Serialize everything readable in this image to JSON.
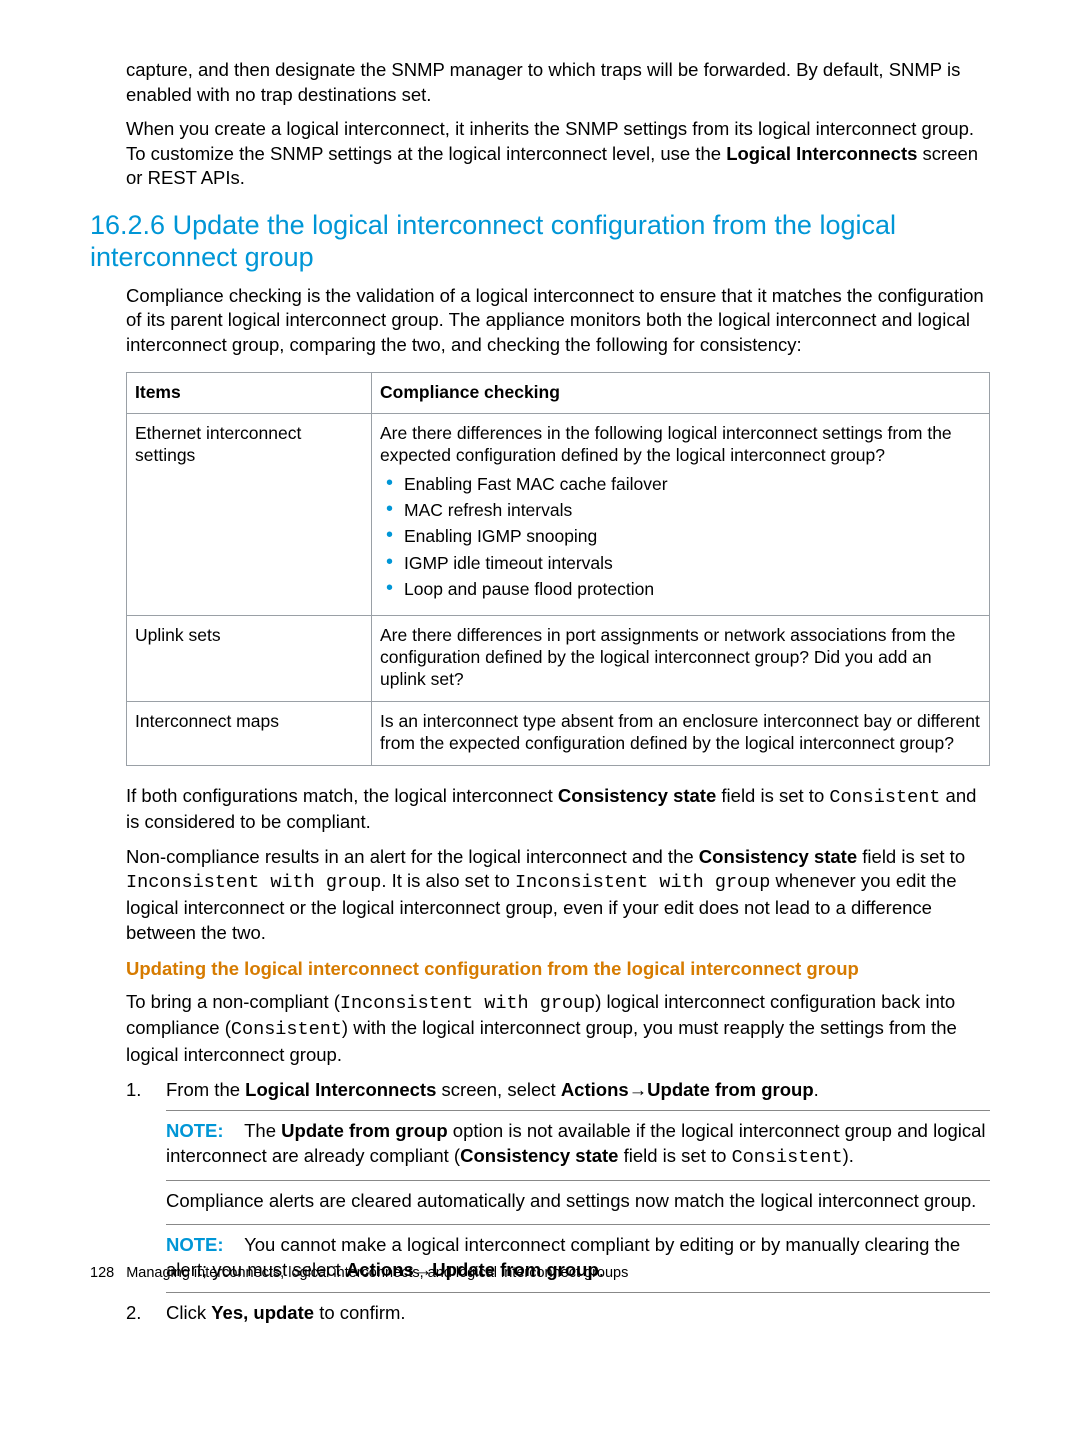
{
  "intro": {
    "p1_a": "capture, and then designate the SNMP manager to which traps will be forwarded. By default, SNMP is enabled with no trap destinations set.",
    "p2_a": "When you create a logical interconnect, it inherits the SNMP settings from its logical interconnect group. To customize the SNMP settings at the logical interconnect level, use the ",
    "p2_bold": "Logical Interconnects",
    "p2_b": " screen or REST APIs."
  },
  "section_heading": "16.2.6 Update the logical interconnect configuration from the logical interconnect group",
  "compliance_intro": "Compliance checking is the validation of a logical interconnect to ensure that it matches the configuration of its parent logical interconnect group. The appliance monitors both the logical interconnect and logical interconnect group, comparing the two, and checking the following for consistency:",
  "table": {
    "headers": {
      "items": "Items",
      "checking": "Compliance checking"
    },
    "rows": [
      {
        "item": "Ethernet interconnect settings",
        "lead": "Are there differences in the following logical interconnect settings from the expected configuration defined by the logical interconnect group?",
        "bullets": [
          "Enabling Fast MAC cache failover",
          "MAC refresh intervals",
          "Enabling IGMP snooping",
          "IGMP idle timeout intervals",
          "Loop and pause flood protection"
        ]
      },
      {
        "item": "Uplink sets",
        "lead": "Are there differences in port assignments or network associations from the configuration defined by the logical interconnect group? Did you add an uplink set?"
      },
      {
        "item": "Interconnect maps",
        "lead": "Is an interconnect type absent from an enclosure interconnect bay or different from the expected configuration defined by the logical interconnect group?"
      }
    ]
  },
  "post_table": {
    "p1_a": "If both configurations match, the logical interconnect ",
    "p1_bold": "Consistency state",
    "p1_b": " field is set to ",
    "p1_code": "Consistent",
    "p1_c": " and is considered to be compliant.",
    "p2_a": "Non-compliance results in an alert for the logical interconnect and the ",
    "p2_bold": "Consistency state",
    "p2_b": " field is set to ",
    "p2_code1": "Inconsistent with group",
    "p2_c": ". It is also set to ",
    "p2_code2": "Inconsistent with group",
    "p2_d": " whenever you edit the logical interconnect or the logical interconnect group, even if your edit does not lead to a difference between the two."
  },
  "update_heading": "Updating the logical interconnect configuration from the logical interconnect group",
  "update_intro": {
    "a": "To bring a non-compliant (",
    "code1": "Inconsistent with group",
    "b": ") logical interconnect configuration back into compliance (",
    "code2": "Consistent",
    "c": ") with the logical interconnect group, you must reapply the settings from the logical interconnect group."
  },
  "steps": {
    "s1": {
      "a": "From the ",
      "b_logical": "Logical Interconnects",
      "b": " screen, select ",
      "b_actions": "Actions",
      "arrow": "→",
      "b_update": "Update from group",
      "c": "."
    },
    "note1": {
      "label": "NOTE:",
      "a": "The ",
      "b_update": "Update from group",
      "b": " option is not available if the logical interconnect group and logical interconnect are already compliant (",
      "b_cs": "Consistency state",
      "c": " field is set to ",
      "code": "Consistent",
      "d": ")."
    },
    "mid": "Compliance alerts are cleared automatically and settings now match the logical interconnect group.",
    "note2": {
      "label": "NOTE:",
      "a": "You cannot make a logical interconnect compliant by editing or by manually clearing the alert; you must select ",
      "b_actions": "Actions",
      "arrow": "→",
      "b_update": "Update from group",
      "c": "."
    },
    "s2": {
      "a": "Click ",
      "b_yes": "Yes, update",
      "b": " to confirm."
    }
  },
  "footer": {
    "page": "128",
    "text": "Managing interconnects, logical interconnects, and logical interconnect groups"
  }
}
